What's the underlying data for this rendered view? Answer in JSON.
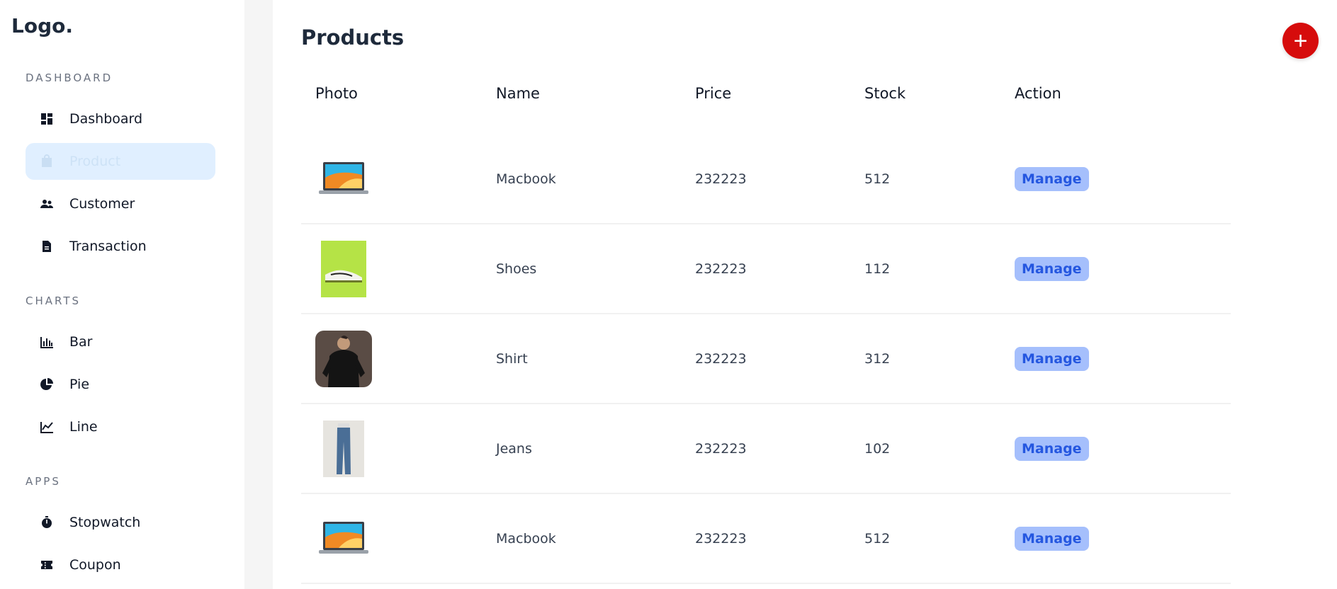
{
  "logo": "Logo.",
  "sidebar": {
    "sections": [
      {
        "title": "DASHBOARD"
      },
      {
        "title": "CHARTS"
      },
      {
        "title": "APPS"
      }
    ],
    "items": [
      {
        "label": "Dashboard",
        "icon": "dashboard-icon",
        "active": false
      },
      {
        "label": "Product",
        "icon": "bag-icon",
        "active": true
      },
      {
        "label": "Customer",
        "icon": "users-icon",
        "active": false
      },
      {
        "label": "Transaction",
        "icon": "document-icon",
        "active": false
      },
      {
        "label": "Bar",
        "icon": "bar-chart-icon",
        "active": false
      },
      {
        "label": "Pie",
        "icon": "pie-chart-icon",
        "active": false
      },
      {
        "label": "Line",
        "icon": "line-chart-icon",
        "active": false
      },
      {
        "label": "Stopwatch",
        "icon": "stopwatch-icon",
        "active": false
      },
      {
        "label": "Coupon",
        "icon": "coupon-icon",
        "active": false
      }
    ]
  },
  "main": {
    "title": "Products",
    "add_button": "+",
    "table": {
      "headers": [
        "Photo",
        "Name",
        "Price",
        "Stock",
        "Action"
      ],
      "rows": [
        {
          "photo": "laptop-image",
          "name": "Macbook",
          "price": "232223",
          "stock": "512",
          "action": "Manage"
        },
        {
          "photo": "shoe-image",
          "name": "Shoes",
          "price": "232223",
          "stock": "112",
          "action": "Manage"
        },
        {
          "photo": "shirt-image",
          "name": "Shirt",
          "price": "232223",
          "stock": "312",
          "action": "Manage"
        },
        {
          "photo": "jeans-image",
          "name": "Jeans",
          "price": "232223",
          "stock": "102",
          "action": "Manage"
        },
        {
          "photo": "laptop-image",
          "name": "Macbook",
          "price": "232223",
          "stock": "512",
          "action": "Manage"
        }
      ]
    }
  },
  "colors": {
    "accent_red": "#d60c0c",
    "manage_bg": "#a5bffc",
    "manage_text": "#2557e0",
    "active_bg": "#e0efff"
  }
}
